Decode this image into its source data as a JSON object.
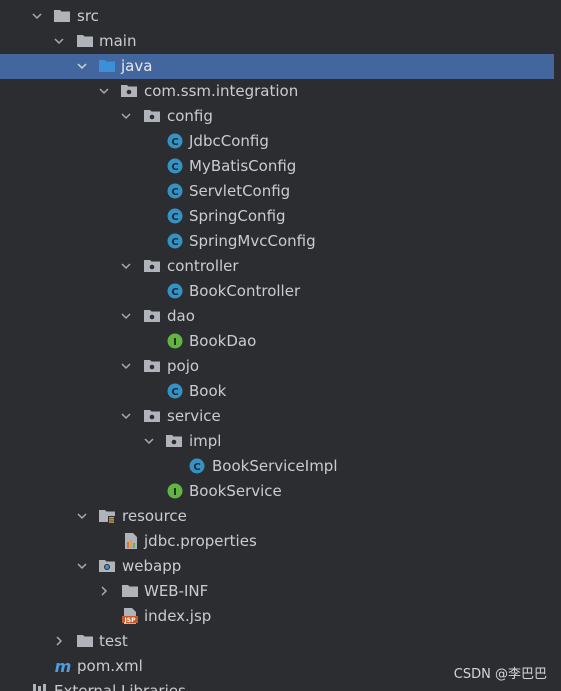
{
  "tree": {
    "src": "src",
    "main": "main",
    "java": "java",
    "package": "com.ssm.integration",
    "config": "config",
    "jdbc_config": "JdbcConfig",
    "mybatis_config": "MyBatisConfig",
    "servlet_config": "ServletConfig",
    "spring_config": "SpringConfig",
    "springmvc_config": "SpringMvcConfig",
    "controller": "controller",
    "book_controller": "BookController",
    "dao": "dao",
    "book_dao": "BookDao",
    "pojo": "pojo",
    "book": "Book",
    "service": "service",
    "impl": "impl",
    "book_service_impl": "BookServiceImpl",
    "book_service": "BookService",
    "resource": "resource",
    "jdbc_properties": "jdbc.properties",
    "webapp": "webapp",
    "web_inf": "WEB-INF",
    "index_jsp": "index.jsp",
    "test": "test",
    "pom": "pom.xml",
    "external_libraries": "External Libraries"
  },
  "icons": {
    "folder": "folder-icon",
    "source_folder": "source-folder-icon",
    "package": "package-icon",
    "class": "class-icon",
    "interface": "interface-icon",
    "resources_folder": "resources-folder-icon",
    "web_folder": "web-folder-icon",
    "properties": "properties-file-icon",
    "jsp": "jsp-file-icon",
    "maven": "maven-icon",
    "library": "library-icon"
  },
  "colors": {
    "background": "#2b2d30",
    "selection": "#43669f",
    "text": "#c9ccd1",
    "class_badge": "#3592c4",
    "interface_badge": "#62b543",
    "folder": "#b0b4ba",
    "source_folder": "#3d8fd6"
  },
  "watermark": "CSDN @李巴巴"
}
